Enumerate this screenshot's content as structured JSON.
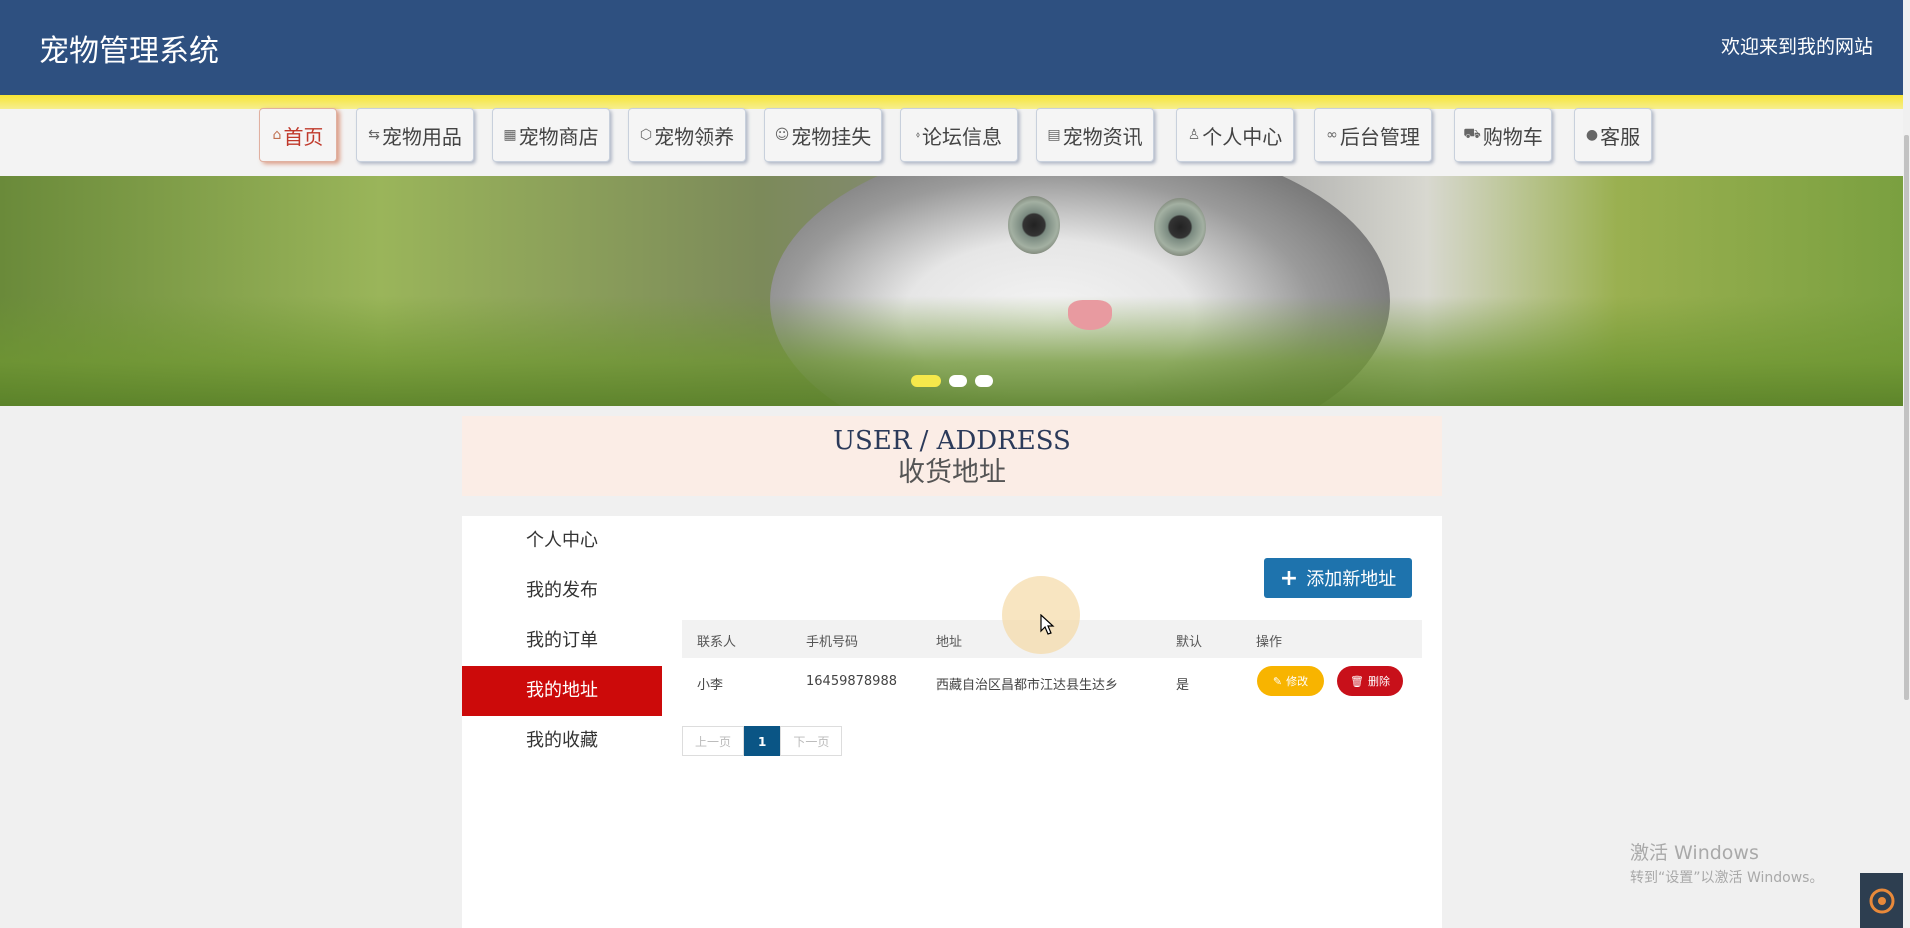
{
  "header": {
    "title": "宠物管理系统",
    "welcome": "欢迎来到我的网站"
  },
  "nav": [
    {
      "icon": "home-icon",
      "glyph": "⌂",
      "label": "首页"
    },
    {
      "icon": "sliders-icon",
      "glyph": "⇆",
      "label": "宠物用品"
    },
    {
      "icon": "calendar-icon",
      "glyph": "▦",
      "label": "宠物商店"
    },
    {
      "icon": "cube-icon",
      "glyph": "⬡",
      "label": "宠物领养"
    },
    {
      "icon": "face-icon",
      "glyph": "☺",
      "label": "宠物挂失"
    },
    {
      "icon": "tag-icon",
      "glyph": "⬫",
      "label": "论坛信息"
    },
    {
      "icon": "news-icon",
      "glyph": "▤",
      "label": "宠物资讯"
    },
    {
      "icon": "user-icon",
      "glyph": "♙",
      "label": "个人中心"
    },
    {
      "icon": "link-icon",
      "glyph": "∞",
      "label": "后台管理"
    },
    {
      "icon": "cart-icon",
      "glyph": "⛟",
      "label": "购物车"
    },
    {
      "icon": "chat-icon",
      "glyph": "●",
      "label": "客服"
    }
  ],
  "banner": {
    "active_slide": 1,
    "slide_count": 3
  },
  "section": {
    "title_en": "USER / ADDRESS",
    "title_cn": "收货地址"
  },
  "sidebar": [
    {
      "label": "个人中心",
      "active": false
    },
    {
      "label": "我的发布",
      "active": false
    },
    {
      "label": "我的订单",
      "active": false
    },
    {
      "label": "我的地址",
      "active": true
    },
    {
      "label": "我的收藏",
      "active": false
    }
  ],
  "add_button": {
    "label": "添加新地址"
  },
  "table": {
    "headers": [
      "联系人",
      "手机号码",
      "地址",
      "默认",
      "操作"
    ],
    "rows": [
      {
        "contact": "小李",
        "phone": "16459878988",
        "address": "西藏自治区昌都市江达县生达乡",
        "default": "是",
        "edit": "修改",
        "delete": "删除"
      }
    ]
  },
  "pager": {
    "prev": "上一页",
    "current": "1",
    "next": "下一页"
  },
  "watermark": {
    "line1": "激活 Windows",
    "line2": "转到“设置”以激活 Windows。"
  },
  "colors": {
    "header_bg": "#2e5080",
    "active_red": "#cc0a0a",
    "primary_blue": "#1e73ad",
    "edit_yellow": "#f8b400",
    "delete_red": "#c8101a",
    "pager_active": "#0a5585"
  }
}
